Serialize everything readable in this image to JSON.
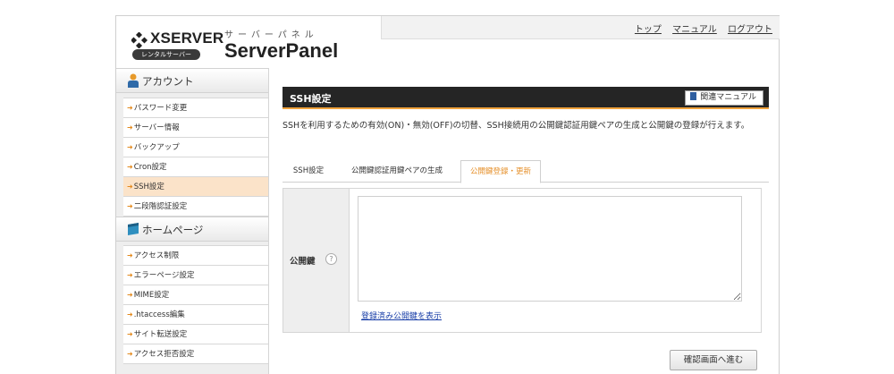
{
  "header": {
    "brand": "XSERVER",
    "badge": "レンタルサーバー",
    "kana": "サーバーパネル",
    "title": "ServerPanel",
    "links": [
      "トップ",
      "マニュアル",
      "ログアウト"
    ]
  },
  "sidebar": {
    "categories": [
      {
        "label": "アカウント",
        "icon": "person-icon",
        "items": [
          "パスワード変更",
          "サーバー情報",
          "バックアップ",
          "Cron設定",
          "SSH設定",
          "二段階認証設定"
        ]
      },
      {
        "label": "ホームページ",
        "icon": "monitor-icon",
        "items": [
          "アクセス制限",
          "エラーページ設定",
          "MIME設定",
          ".htaccess編集",
          "サイト転送設定",
          "アクセス拒否設定"
        ]
      }
    ],
    "active_item": "SSH設定"
  },
  "main": {
    "title": "SSH設定",
    "manual_button": "関連マニュアル",
    "description": "SSHを利用するための有効(ON)・無効(OFF)の切替、SSH接続用の公開鍵認証用鍵ペアの生成と公開鍵の登録が行えます。",
    "tabs": [
      "SSH設定",
      "公開鍵認証用鍵ペアの生成",
      "公開鍵登録・更新"
    ],
    "active_tab": "公開鍵登録・更新",
    "field_label": "公開鍵",
    "help_symbol": "?",
    "textarea_value": "",
    "show_link": "登録済み公開鍵を表示",
    "confirm_button": "確認画面へ進む"
  },
  "colors": {
    "accent": "#f0a33c",
    "active_tab_text": "#e6902b",
    "active_menu_bg": "#fbe3c9",
    "title_bar": "#252525",
    "link": "#1a3fa8"
  }
}
